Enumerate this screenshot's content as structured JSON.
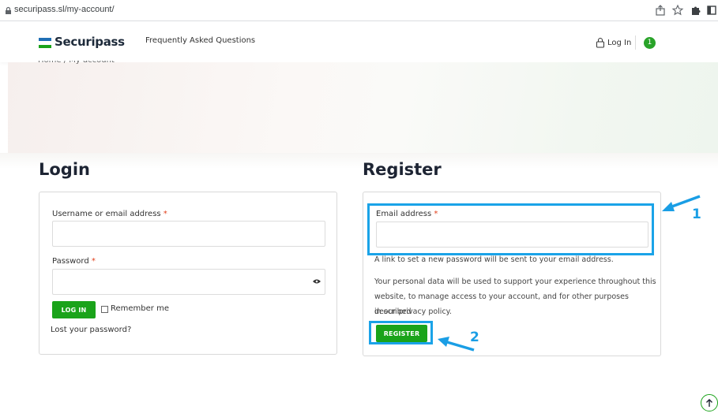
{
  "browser": {
    "url": "securipass.sl/my-account/"
  },
  "header": {
    "logo_text": "Securipass",
    "nav_faq": "Frequently Asked Questions",
    "login_label": "Log In",
    "cart_count": "1"
  },
  "breadcrumb": "Home / My account",
  "login": {
    "heading": "Login",
    "username_label": "Username or email address",
    "password_label": "Password",
    "required_mark": "*",
    "username_value": "",
    "password_value": "",
    "login_button": "LOG IN",
    "remember_label": "Remember me",
    "lost_password": "Lost your password?"
  },
  "register": {
    "heading": "Register",
    "email_label": "Email address",
    "required_mark": "*",
    "email_value": "",
    "note": "A link to set a new password will be sent to your email address.",
    "privacy_line1": "Your personal data will be used to support your experience throughout this",
    "privacy_line2": "website, to manage access to your account, and for other purposes described",
    "privacy_line3": "in our privacy policy.",
    "register_button": "REGISTER"
  },
  "annotations": {
    "marker_1": "1",
    "marker_2": "2",
    "highlight_color": "#1aa3e8"
  },
  "colors": {
    "brand_green": "#1aa31a",
    "brand_blue": "#1f6fb5",
    "required_red": "#e2401c"
  }
}
